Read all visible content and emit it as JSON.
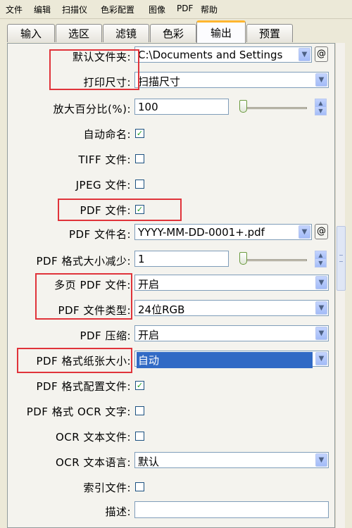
{
  "menubar": {
    "items": [
      "文件",
      "编辑",
      "扫描仪",
      "色彩配置",
      "图像",
      "PDF",
      "帮助"
    ]
  },
  "tabs": [
    "输入",
    "选区",
    "滤镜",
    "色彩",
    "输出",
    "预置"
  ],
  "active_tab": "输出",
  "form": {
    "default_folder": {
      "label": "默认文件夹:",
      "value": "C:\\Documents and Settings",
      "button": "@"
    },
    "print_size": {
      "label": "打印尺寸:",
      "value": "扫描尺寸"
    },
    "zoom_percent": {
      "label": "放大百分比(%):",
      "value": "100"
    },
    "auto_name": {
      "label": "自动命名:",
      "checked": true
    },
    "tiff_file": {
      "label": "TIFF 文件:",
      "checked": false
    },
    "jpeg_file": {
      "label": "JPEG 文件:",
      "checked": false
    },
    "pdf_file": {
      "label": "PDF 文件:",
      "checked": true
    },
    "pdf_filename": {
      "label": "PDF 文件名:",
      "value": "YYYY-MM-DD-0001+.pdf",
      "button": "@"
    },
    "pdf_size_reduce": {
      "label": "PDF 格式大小减少:",
      "value": "1"
    },
    "multipage_pdf": {
      "label": "多页 PDF 文件:",
      "value": "开启"
    },
    "pdf_file_type": {
      "label": "PDF 文件类型:",
      "value": "24位RGB"
    },
    "pdf_compress": {
      "label": "PDF 压缩:",
      "value": "开启"
    },
    "pdf_paper_size": {
      "label": "PDF 格式纸张大小:",
      "value": "自动"
    },
    "pdf_config_file": {
      "label": "PDF 格式配置文件:",
      "checked": true
    },
    "pdf_ocr_text": {
      "label": "PDF 格式 OCR 文字:",
      "checked": false
    },
    "ocr_text_file": {
      "label": "OCR 文本文件:",
      "checked": false
    },
    "ocr_text_lang": {
      "label": "OCR 文本语言:",
      "value": "默认"
    },
    "index_file": {
      "label": "索引文件:",
      "checked": false
    },
    "description": {
      "label": "描述:",
      "value": ""
    }
  },
  "colors": {
    "highlight_box": "#e0333a",
    "active_tab_accent": "#ffb62f",
    "selection": "#316ac5"
  },
  "icons": {
    "dropdown": "chevron-down-icon",
    "check": "checkmark-icon",
    "spin_up": "spin-up-icon",
    "spin_down": "spin-down-icon"
  }
}
